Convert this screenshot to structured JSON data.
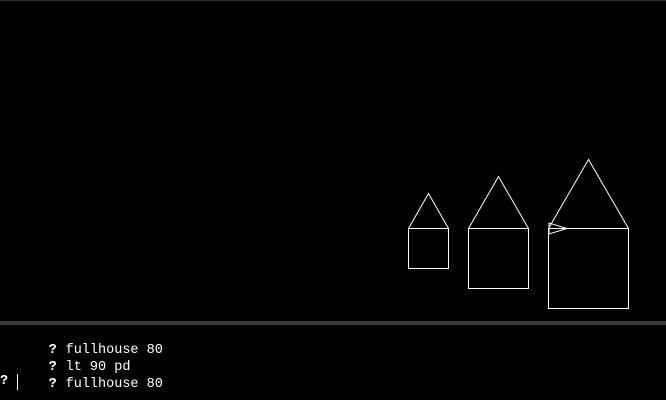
{
  "console": {
    "history": [
      {
        "prompt": "?",
        "command": "fullhouse 80"
      },
      {
        "prompt": "?",
        "command": "lt 90 pd"
      },
      {
        "prompt": "?",
        "command": "fullhouse 80"
      }
    ],
    "input": {
      "prompt": "?",
      "value": ""
    }
  },
  "graphics": {
    "background_color": "#000000",
    "pen_color": "#ffffff",
    "turtle_icon": "turtle-triangle"
  }
}
